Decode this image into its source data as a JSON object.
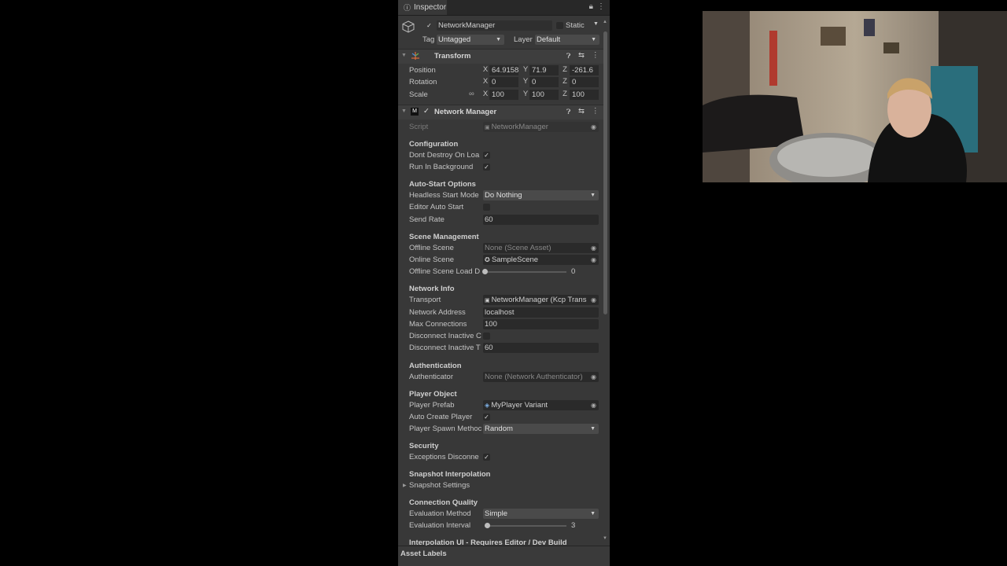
{
  "tab": {
    "title": "Inspector"
  },
  "gameobject": {
    "name": "NetworkManager",
    "static_label": "Static",
    "tag_label": "Tag",
    "tag_value": "Untagged",
    "layer_label": "Layer",
    "layer_value": "Default"
  },
  "transform": {
    "title": "Transform",
    "position": {
      "label": "Position",
      "x": "64.9158",
      "y": "71.9",
      "z": "-261.6"
    },
    "rotation": {
      "label": "Rotation",
      "x": "0",
      "y": "0",
      "z": "0"
    },
    "scale": {
      "label": "Scale",
      "x": "100",
      "y": "100",
      "z": "100"
    }
  },
  "axes": {
    "x": "X",
    "y": "Y",
    "z": "Z"
  },
  "nm": {
    "title": "Network Manager",
    "script_label": "Script",
    "script_value": "NetworkManager",
    "configuration": "Configuration",
    "dont_destroy": "Dont Destroy On Loa",
    "run_in_bg": "Run In Background",
    "autostart": "Auto-Start Options",
    "headless_mode": "Headless Start Mode",
    "headless_value": "Do Nothing",
    "editor_auto": "Editor Auto Start",
    "send_rate": "Send Rate",
    "send_rate_value": "60",
    "scene_mgmt": "Scene Management",
    "offline_scene": "Offline Scene",
    "offline_scene_value": "None (Scene Asset)",
    "online_scene": "Online Scene",
    "online_scene_value": "SampleScene",
    "offline_delay": "Offline Scene Load D",
    "offline_delay_value": "0",
    "network_info": "Network Info",
    "transport": "Transport",
    "transport_value": "NetworkManager (Kcp Trans",
    "net_address": "Network Address",
    "net_address_value": "localhost",
    "max_conn": "Max Connections",
    "max_conn_value": "100",
    "disc_inactive": "Disconnect Inactive C",
    "disc_inactive_t": "Disconnect Inactive T",
    "disc_inactive_t_value": "60",
    "authentication": "Authentication",
    "authenticator": "Authenticator",
    "authenticator_value": "None (Network Authenticator)",
    "player_object": "Player Object",
    "player_prefab": "Player Prefab",
    "player_prefab_value": "MyPlayer Variant",
    "auto_create": "Auto Create Player",
    "spawn_method": "Player Spawn Methoc",
    "spawn_value": "Random",
    "security": "Security",
    "exceptions": "Exceptions Disconne",
    "snap_interp": "Snapshot Interpolation",
    "snap_settings": "Snapshot Settings",
    "conn_quality": "Connection Quality",
    "eval_method": "Evaluation Method",
    "eval_method_value": "Simple",
    "eval_interval": "Evaluation Interval",
    "eval_interval_value": "3",
    "interp_ui": "Interpolation UI - Requires Editor / Dev Build"
  },
  "footer": {
    "asset_labels": "Asset Labels"
  },
  "sliders": {
    "offline_delay_fraction": 0.0,
    "eval_interval_fraction": 0.03
  },
  "colors": {
    "panel": "#383838",
    "field": "#2a2a2a",
    "dropdown": "#4a4a4a",
    "background": "#000000"
  }
}
